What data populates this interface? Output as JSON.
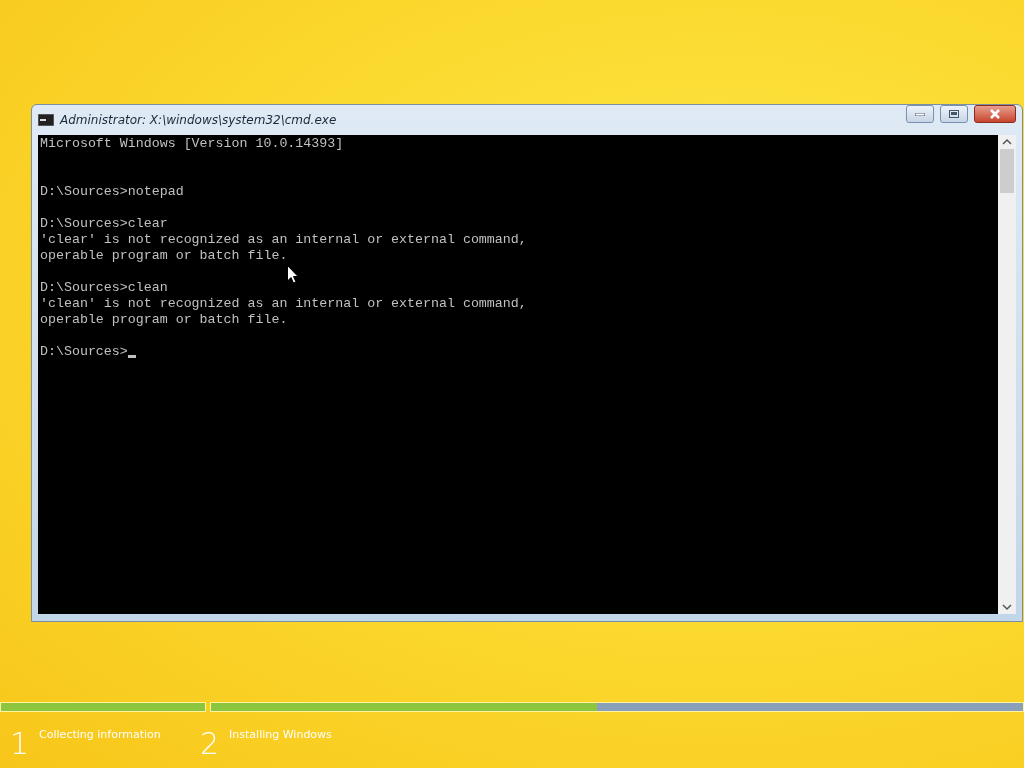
{
  "window": {
    "title": "Administrator: X:\\windows\\system32\\cmd.exe"
  },
  "console": {
    "output": "Microsoft Windows [Version 10.0.14393]\n\n\nD:\\Sources>notepad\n\nD:\\Sources>clear\n'clear' is not recognized as an internal or external command,\noperable program or batch file.\n\nD:\\Sources>clean\n'clean' is not recognized as an internal or external command,\noperable program or batch file.\n",
    "prompt": "D:\\Sources>"
  },
  "progress": [
    {
      "level": 1
    },
    {
      "level": 0.475
    }
  ],
  "steps": [
    {
      "number": "1",
      "label": "Collecting information"
    },
    {
      "number": "2",
      "label": "Installing Windows"
    }
  ]
}
